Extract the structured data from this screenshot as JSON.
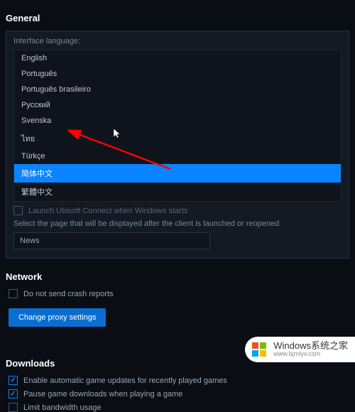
{
  "general": {
    "title": "General",
    "lang_label": "Interface language:",
    "languages": [
      "English",
      "Português",
      "Português brasileiro",
      "Русский",
      "Svenska",
      "ไทย",
      "Türkçe",
      "简体中文",
      "繁體中文"
    ],
    "launch_on_start": "Launch Ubisoft Connect when Windows starts",
    "start_page_label": "Select the page that will be displayed after the client is launched or reopened",
    "start_page_value": "News"
  },
  "network": {
    "title": "Network",
    "no_crash": "Do not send crash reports",
    "proxy_btn": "Change proxy settings"
  },
  "downloads": {
    "title": "Downloads",
    "auto_update": "Enable automatic game updates for recently played games",
    "pause_playing": "Pause game downloads when playing a game",
    "limit_bw": "Limit bandwidth usage"
  },
  "watermark": {
    "main": "Windows系统之家",
    "sub": "www.bjmlyv.com"
  }
}
